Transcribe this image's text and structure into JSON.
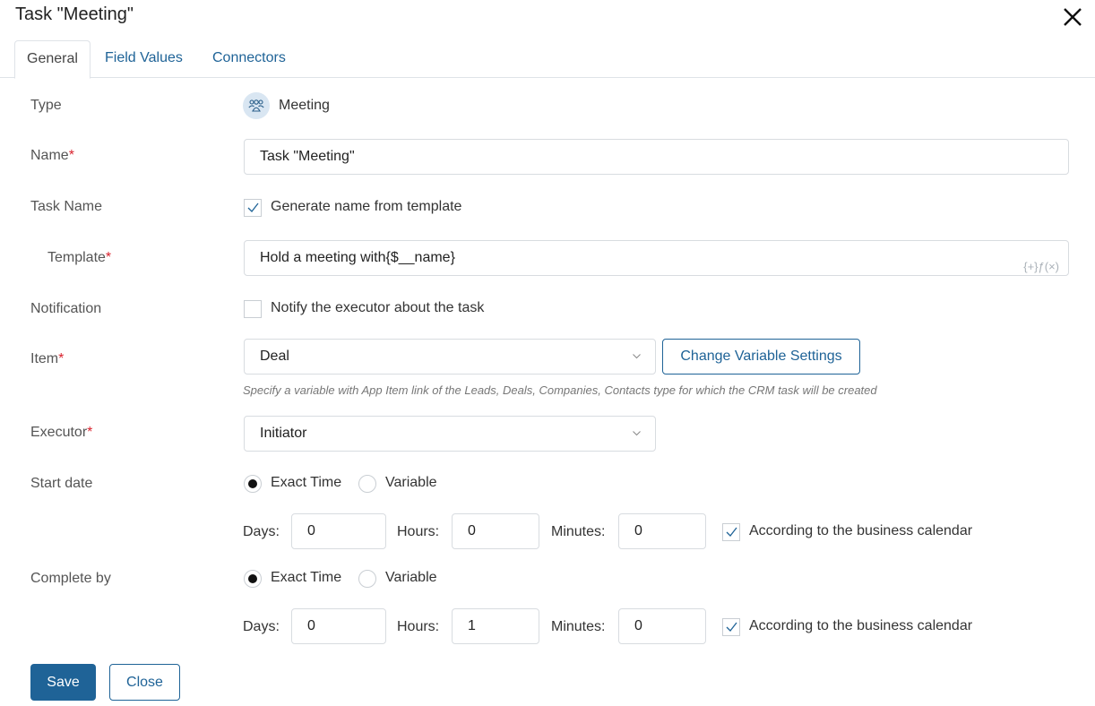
{
  "dialog": {
    "title": "Task \"Meeting\"",
    "close_icon": "close-icon"
  },
  "tabs": [
    {
      "label": "General",
      "active": true
    },
    {
      "label": "Field Values",
      "active": false
    },
    {
      "label": "Connectors",
      "active": false
    }
  ],
  "form": {
    "type": {
      "label": "Type",
      "icon": "people-group-icon",
      "value": "Meeting"
    },
    "name": {
      "label": "Name",
      "required_mark": "*",
      "value": "Task \"Meeting\""
    },
    "task_name": {
      "label": "Task Name",
      "checkbox_label": "Generate name from template",
      "checked": true
    },
    "template": {
      "label": "Template",
      "required_mark": "*",
      "value": "Hold a meeting with{$__name}",
      "insert_label": "{+}ƒ(×)"
    },
    "notification": {
      "label": "Notification",
      "checkbox_label": "Notify the executor about the task",
      "checked": false
    },
    "item": {
      "label": "Item",
      "required_mark": "*",
      "value": "Deal",
      "button_label": "Change Variable Settings",
      "hint": "Specify a variable with App Item link of the Leads, Deals, Companies, Contacts type for which the CRM task will be created"
    },
    "executor": {
      "label": "Executor",
      "required_mark": "*",
      "value": "Initiator"
    },
    "start_date": {
      "label": "Start date",
      "options": [
        {
          "label": "Exact Time",
          "selected": true
        },
        {
          "label": "Variable",
          "selected": false
        }
      ],
      "days_label": "Days:",
      "days": "0",
      "hours_label": "Hours:",
      "hours": "0",
      "minutes_label": "Minutes:",
      "minutes": "0",
      "calendar_label": "According to the business calendar",
      "calendar_checked": true
    },
    "complete_by": {
      "label": "Complete by",
      "options": [
        {
          "label": "Exact Time",
          "selected": true
        },
        {
          "label": "Variable",
          "selected": false
        }
      ],
      "days_label": "Days:",
      "days": "0",
      "hours_label": "Hours:",
      "hours": "1",
      "minutes_label": "Minutes:",
      "minutes": "0",
      "calendar_label": "According to the business calendar",
      "calendar_checked": true
    }
  },
  "footer": {
    "save_label": "Save",
    "close_label": "Close"
  },
  "colors": {
    "accent": "#1f6397",
    "required": "#d9232e"
  }
}
